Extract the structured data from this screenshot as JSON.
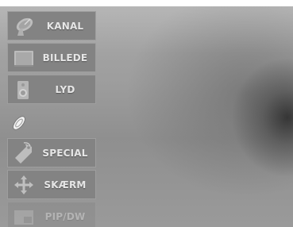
{
  "menu": {
    "items": [
      {
        "label": "KANAL",
        "icon": "satellite-dish-icon"
      },
      {
        "label": "BILLEDE",
        "icon": "picture-frame-icon"
      },
      {
        "label": "LYD",
        "icon": "speaker-icon"
      },
      {
        "label": "",
        "icon": "remote-control-icon"
      },
      {
        "label": "SPECIAL",
        "icon": "tag-icon"
      },
      {
        "label": "SKÆRM",
        "icon": "move-arrows-icon"
      },
      {
        "label": "PIP/DW",
        "icon": "pip-window-icon"
      }
    ]
  },
  "colors": {
    "menu_item_bg": "#838383",
    "label_text": "#e6e6e6"
  }
}
